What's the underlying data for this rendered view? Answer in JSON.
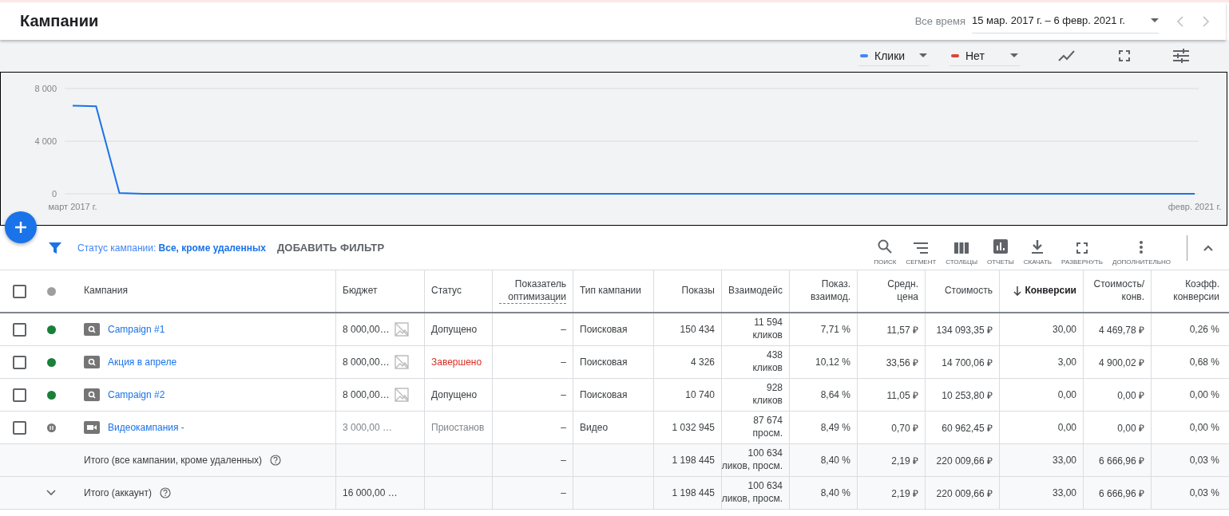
{
  "header": {
    "title": "Кампании",
    "period_label": "Все время",
    "date_range": "15 мар. 2017 г. – 6 февр. 2021 г."
  },
  "chart_controls": {
    "metrics": [
      {
        "label": "Клики",
        "color": "#4285f4"
      },
      {
        "label": "Нет",
        "color": "#db4437"
      }
    ],
    "tools": [
      {
        "kind": "chart-type"
      },
      {
        "kind": "expand"
      },
      {
        "kind": "adjust"
      }
    ]
  },
  "chart": {
    "chart_data": {
      "type": "line",
      "series": [
        {
          "color": "#1a73e8",
          "values": [
            6700,
            6650,
            60,
            0,
            0,
            0,
            0,
            0,
            0,
            0,
            0,
            0,
            0,
            0,
            0,
            0,
            0,
            0,
            0,
            0,
            0,
            0,
            0,
            0,
            0,
            0,
            0,
            0,
            0,
            0,
            0,
            0,
            0,
            0,
            0,
            0,
            0,
            0,
            0,
            0,
            0,
            0,
            0,
            0,
            0,
            0,
            0,
            0,
            0
          ]
        }
      ],
      "categories": [
        "март 2017 г.",
        null,
        null,
        null,
        null,
        null,
        null,
        null,
        null,
        null,
        null,
        null,
        null,
        null,
        null,
        null,
        null,
        null,
        null,
        null,
        null,
        null,
        null,
        null,
        null,
        null,
        null,
        null,
        null,
        null,
        null,
        null,
        null,
        null,
        null,
        null,
        null,
        null,
        null,
        null,
        null,
        null,
        null,
        null,
        null,
        null,
        null,
        null,
        "февр. 2021 г."
      ],
      "ylim": [
        0,
        8000
      ],
      "yticks": [
        {
          "value": 0,
          "label": "0"
        },
        {
          "value": 4000,
          "label": "4 000"
        },
        {
          "value": 8000,
          "label": "8 000"
        }
      ]
    }
  },
  "filter": {
    "label": "Статус кампании:",
    "value": "Все, кроме удаленных",
    "add_button": "ДОБАВИТЬ ФИЛЬТР"
  },
  "toolbar": [
    {
      "kind": "search",
      "label": "ПОИСК"
    },
    {
      "kind": "segment",
      "label": "СЕГМЕНТ"
    },
    {
      "kind": "columns",
      "label": "СТОЛБЦЫ"
    },
    {
      "kind": "reports",
      "label": "ОТЧЕТЫ"
    },
    {
      "kind": "download",
      "label": "СКАЧАТЬ"
    },
    {
      "kind": "expand",
      "label": "РАЗВЕРНУТЬ"
    },
    {
      "kind": "more",
      "label": "ДОПОЛНИТЕЛЬНО"
    }
  ],
  "table": {
    "select_all": {
      "checked": false
    },
    "columns": [
      {
        "label": "Кампания"
      },
      {
        "label": "Бюджет"
      },
      {
        "label": "Статус"
      },
      {
        "label": "Показатель оптимизации",
        "underlined": true
      },
      {
        "label": "Тип кампании"
      },
      {
        "label": "Показы"
      },
      {
        "label": "Взаимодейс"
      },
      {
        "label": "Показ. взаимод."
      },
      {
        "label": "Средн. цена"
      },
      {
        "label": "Стоимость"
      },
      {
        "label": "Конверсии",
        "sorted": true
      },
      {
        "label": "Стоимость/ конв."
      },
      {
        "label": "Коэфф. конверсии"
      }
    ],
    "rows": [
      {
        "checked": false,
        "paused": false,
        "kind": "search",
        "name": "Campaign #1",
        "budget": "8 000,00…",
        "budget_limited": true,
        "status": {
          "label": "Допущено",
          "color": "#3c4043"
        },
        "optimization": "–",
        "campaign_type": "Поисковая",
        "impressions": "150 434",
        "interactions": [
          "11 594",
          "кликов"
        ],
        "interaction_rate": "7,71 %",
        "avg_cost": "11,57 ₽",
        "cost": "134 093,35 ₽",
        "conversions": "30,00",
        "cost_per_conv": "4 469,78 ₽",
        "conv_rate": "0,26 %"
      },
      {
        "checked": false,
        "paused": false,
        "kind": "search",
        "name": "Акция в апреле",
        "budget": "8 000,00…",
        "budget_limited": true,
        "status": {
          "label": "Завершено",
          "color": "#d93025"
        },
        "optimization": "–",
        "campaign_type": "Поисковая",
        "impressions": "4 326",
        "interactions": [
          "438",
          "кликов"
        ],
        "interaction_rate": "10,12 %",
        "avg_cost": "33,56 ₽",
        "cost": "14 700,06 ₽",
        "conversions": "3,00",
        "cost_per_conv": "4 900,02 ₽",
        "conv_rate": "0,68 %"
      },
      {
        "checked": false,
        "paused": false,
        "kind": "search",
        "name": "Campaign #2",
        "budget": "8 000,00…",
        "budget_limited": true,
        "status": {
          "label": "Допущено",
          "color": "#3c4043"
        },
        "optimization": "–",
        "campaign_type": "Поисковая",
        "impressions": "10 740",
        "interactions": [
          "928",
          "кликов"
        ],
        "interaction_rate": "8,64 %",
        "avg_cost": "11,05 ₽",
        "cost": "10 253,80 ₽",
        "conversions": "0,00",
        "cost_per_conv": "0,00 ₽",
        "conv_rate": "0,00 %"
      },
      {
        "checked": false,
        "paused": true,
        "kind": "video",
        "name": "Видеокампания -",
        "budget": "3 000,00 …",
        "budget_limited": false,
        "status": {
          "label": "Приостанов",
          "color": "#80868b"
        },
        "optimization": "–",
        "campaign_type": "Видео",
        "impressions": "1 032 945",
        "interactions": [
          "87 674",
          "просм."
        ],
        "interaction_rate": "8,49 %",
        "avg_cost": "0,70 ₽",
        "cost": "60 962,45 ₽",
        "conversions": "0,00",
        "cost_per_conv": "0,00 ₽",
        "conv_rate": "0,00 %"
      }
    ],
    "totals": [
      {
        "collapsible": false,
        "label": "Итого (все кампании, кроме удаленных)",
        "optimization": "–",
        "impressions": "1 198 445",
        "interactions": [
          "100 634",
          "ликов, просм."
        ],
        "interaction_rate": "8,40 %",
        "avg_cost": "2,19 ₽",
        "cost": "220 009,66 ₽",
        "conversions": "33,00",
        "cost_per_conv": "6 666,96 ₽",
        "conv_rate": "0,03 %"
      },
      {
        "collapsible": true,
        "label": "Итого (аккаунт)",
        "budget": "16 000,00 …",
        "optimization": "–",
        "impressions": "1 198 445",
        "interactions": [
          "100 634",
          "ликов, просм."
        ],
        "interaction_rate": "8,40 %",
        "avg_cost": "2,19 ₽",
        "cost": "220 009,66 ₽",
        "conversions": "33,00",
        "cost_per_conv": "6 666,96 ₽",
        "conv_rate": "0,03 %"
      }
    ]
  }
}
